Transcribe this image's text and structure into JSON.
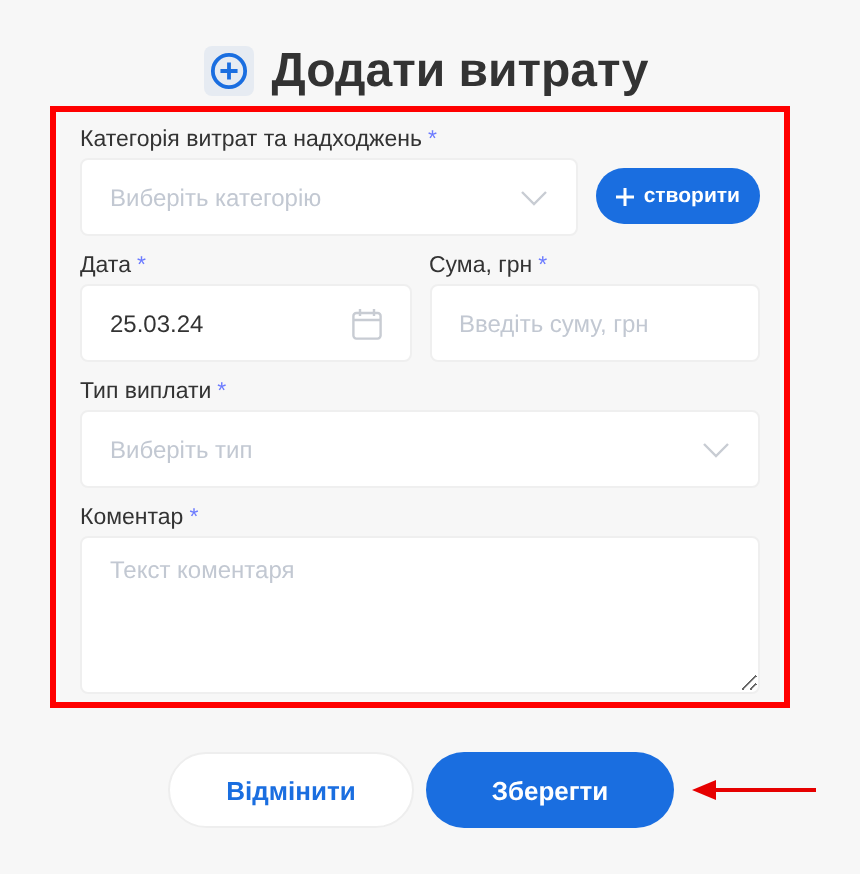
{
  "header": {
    "title": "Додати витрату"
  },
  "rows": [
    [
      {
        "kind": "select",
        "label": "Категорія витрат та надходжень",
        "required_mark": "*",
        "placeholder": "Виберіть категорію",
        "action": {
          "label": "створити"
        }
      }
    ],
    [
      {
        "kind": "date",
        "label": "Дата",
        "required_mark": "*",
        "value": "25.03.24"
      },
      {
        "kind": "text",
        "label": "Сума, грн",
        "required_mark": "*",
        "placeholder": "Введіть суму, грн"
      }
    ],
    [
      {
        "kind": "select",
        "label": "Тип виплати",
        "required_mark": "*",
        "placeholder": "Виберіть тип"
      }
    ],
    [
      {
        "kind": "textarea",
        "label": "Коментар",
        "required_mark": "*",
        "placeholder": "Текст коментаря"
      }
    ]
  ],
  "buttons": [
    {
      "kind": "secondary",
      "label": "Відмінити"
    },
    {
      "kind": "primary",
      "label": "Зберегти"
    }
  ]
}
